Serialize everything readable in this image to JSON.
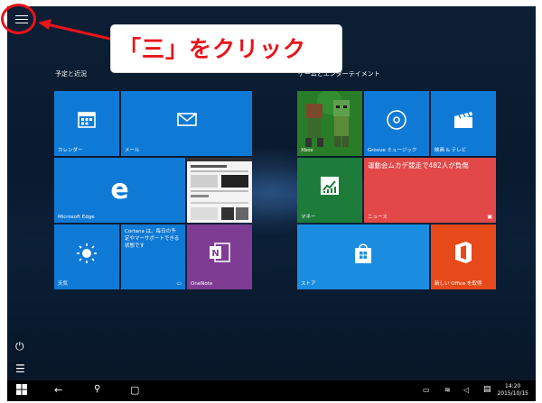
{
  "annotation": {
    "callout_text": "「三」をクリック"
  },
  "start": {
    "left_group_title": "予定と近況",
    "right_group_title": "ゲームとエンターテイメント",
    "tiles": {
      "calendar": "カレンダー",
      "mail": "メール",
      "edge": "Microsoft Edge",
      "weather": "天気",
      "cortana_text": "Cortana は、毎日の予定やマーサポートできる状態です",
      "onenote": "OneNote",
      "xbox": "Xbox",
      "groove": "Groove ミュージック",
      "movies": "映画 & テレビ",
      "money": "マネー",
      "news_headline": "運動会ムカデ競走で482人が負傷",
      "news": "ニュース",
      "store": "ストア",
      "office": "新しい Office を取得"
    }
  },
  "taskbar": {
    "time": "14:20",
    "date": "2015/10/15"
  },
  "icons": [
    "hamburger-icon",
    "power-icon",
    "all-apps-icon",
    "windows-start-icon",
    "back-icon",
    "search-icon",
    "task-view-icon",
    "calendar-icon",
    "mail-icon",
    "edge-icon",
    "weather-icon",
    "onenote-icon",
    "groove-icon",
    "movies-icon",
    "money-icon",
    "store-icon",
    "office-icon"
  ],
  "colors": {
    "accent_blue": "#0f7ad6",
    "annotation_red": "#e8141a",
    "money_green": "#1e7c3b",
    "news_red": "#e24848",
    "office_orange": "#e8491a",
    "onenote_purple": "#7e3d93"
  }
}
